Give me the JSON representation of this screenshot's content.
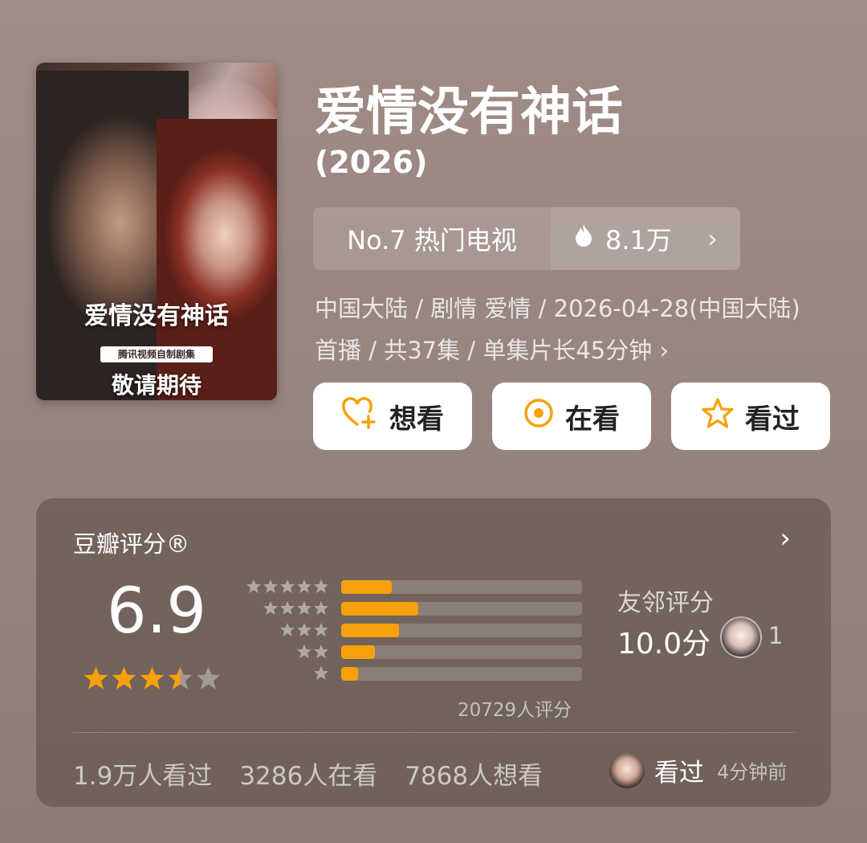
{
  "poster": {
    "title": "爱情没有神话",
    "badge": "腾讯视频自制剧集",
    "subtitle": "敬请期待"
  },
  "title": "爱情没有神话",
  "year": "(2026)",
  "rank": {
    "label": "No.7 热门电视",
    "heat": "8.1万",
    "heat_icon": "flame-icon"
  },
  "meta": "中国大陆 / 剧情 爱情 / 2026-04-28(中国大陆)首播 / 共37集 / 单集片长45分钟",
  "actions": [
    {
      "label": "想看",
      "icon": "heart-plus-icon"
    },
    {
      "label": "在看",
      "icon": "target-circle-icon"
    },
    {
      "label": "看过",
      "icon": "star-outline-icon"
    }
  ],
  "rating": {
    "title": "豆瓣评分®",
    "score": "6.9",
    "stars_value": 3.5,
    "distribution": [
      {
        "stars": 5,
        "fraction": 0.21
      },
      {
        "stars": 4,
        "fraction": 0.32
      },
      {
        "stars": 3,
        "fraction": 0.24
      },
      {
        "stars": 2,
        "fraction": 0.14
      },
      {
        "stars": 1,
        "fraction": 0.07
      }
    ],
    "total": "20729人评分",
    "friends_label": "友邻评分",
    "friends_score": "10.0分",
    "friends_count": "1"
  },
  "stats": {
    "watched": "1.9万人看过",
    "watching": "3286人在看",
    "want": "7868人想看"
  },
  "recent": {
    "status": "看过",
    "time": "4分钟前"
  },
  "colors": {
    "accent": "#f6a10b",
    "bg": "#978580"
  }
}
